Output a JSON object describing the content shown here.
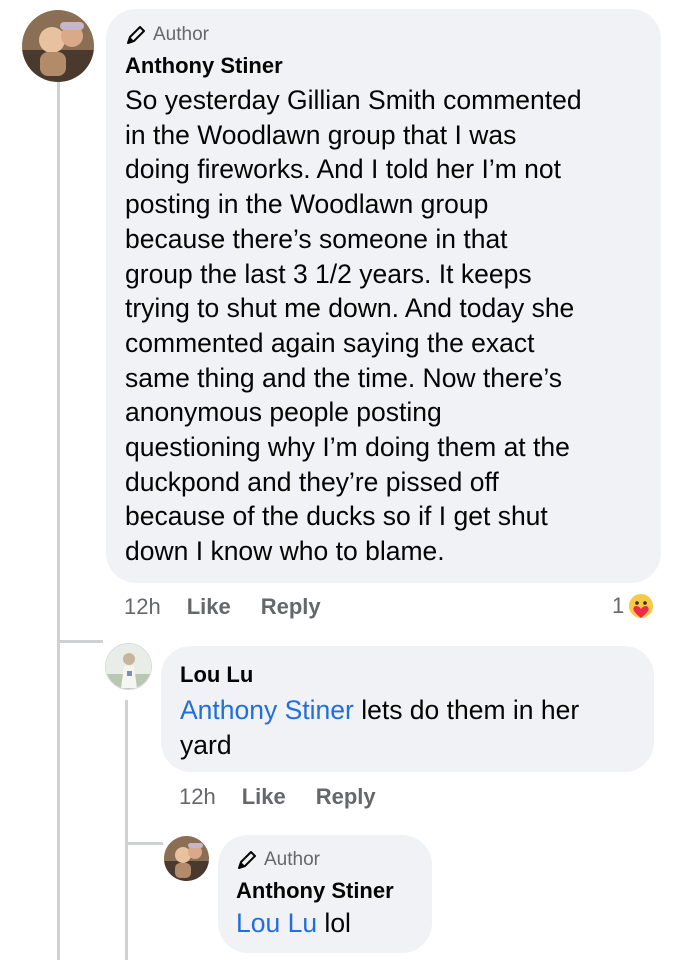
{
  "comments": [
    {
      "badge": "Author",
      "name": "Anthony Stiner",
      "lines": [
        "So yesterday Gillian Smith commented",
        "in the Woodlawn group that I was",
        "doing fireworks. And I told her I’m not",
        "posting in the Woodlawn group",
        "because there’s someone in that",
        "group the last 3 1/2 years. It keeps",
        "trying to shut me down. And today she",
        "commented again saying the exact",
        "same thing and the time. Now there’s",
        "anonymous people posting",
        "questioning why I’m doing them at the",
        "duckpond and they’re pissed off",
        "because of the ducks so if I get shut",
        "down I know who to blame."
      ],
      "time": "12h",
      "like": "Like",
      "reply": "Reply",
      "reaction_count": "1",
      "reaction_icon": "care-reaction-icon"
    },
    {
      "name": "Lou Lu",
      "mention": "Anthony Stiner",
      "text_after_mention": " lets do them in her",
      "text_line2": "yard",
      "time": "12h",
      "like": "Like",
      "reply": "Reply"
    },
    {
      "badge": "Author",
      "name": "Anthony Stiner",
      "mention": "Lou Lu",
      "text_after_mention": " lol"
    }
  ],
  "colors": {
    "bubble": "#f0f2f5",
    "mention": "#216fdb",
    "meta": "#65676b",
    "thread_line": "#ced0d4"
  }
}
